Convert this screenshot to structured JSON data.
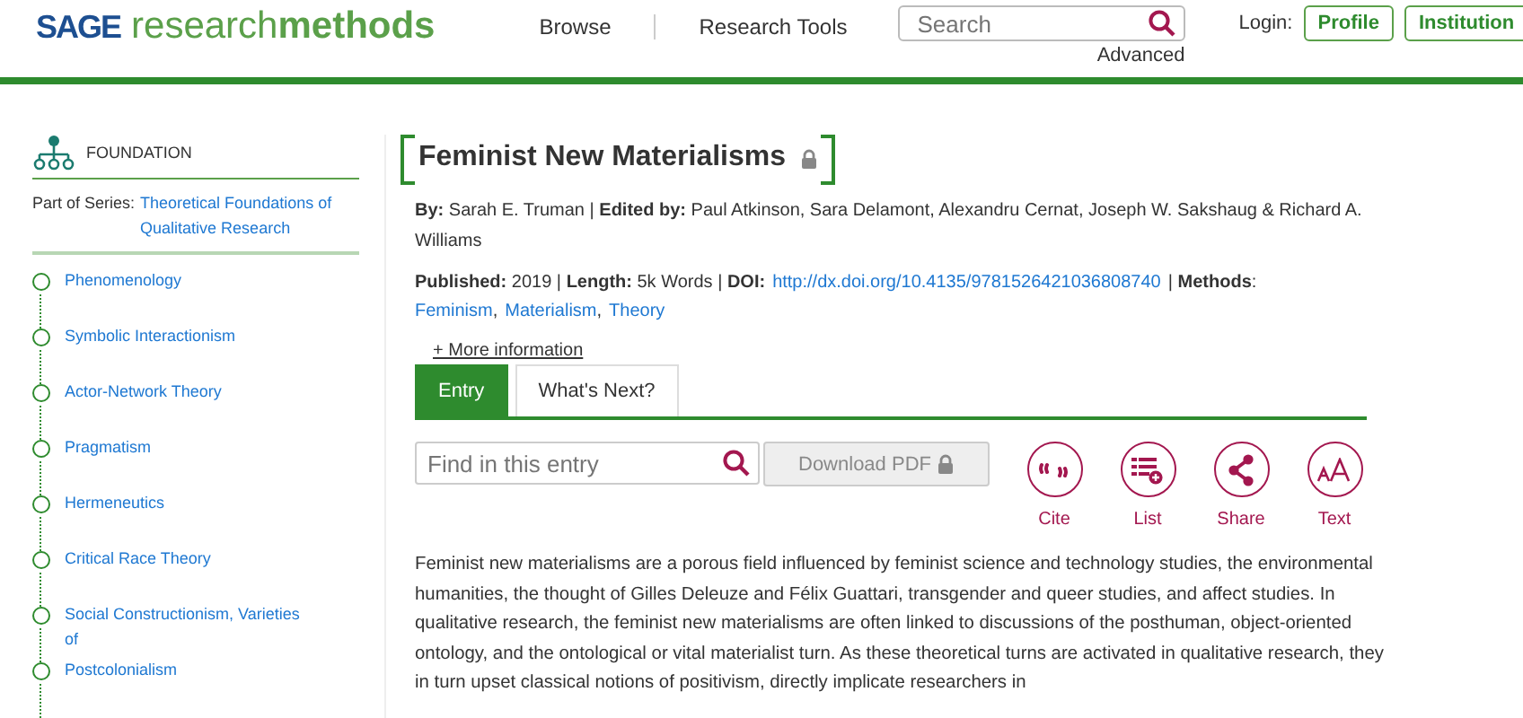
{
  "header": {
    "logo_brand": "SAGE",
    "logo_word_light": "research",
    "logo_word_bold": "methods",
    "nav": [
      "Browse",
      "Research Tools"
    ],
    "search": {
      "placeholder": "Search"
    },
    "advanced": "Advanced",
    "login_label": "Login:",
    "login_buttons": [
      "Profile",
      "Institution"
    ]
  },
  "sidebar": {
    "section": "FOUNDATION",
    "series_label": "Part of Series:",
    "series_link": "Theoretical Foundations of Qualitative Research",
    "items": [
      "Phenomenology",
      "Symbolic Interactionism",
      "Actor-Network Theory",
      "Pragmatism",
      "Hermeneutics",
      "Critical Race Theory",
      "Social Constructionism, Varieties of",
      "Postcolonialism"
    ]
  },
  "article": {
    "title": "Feminist New Materialisms",
    "byline": "**By:** Sarah E. Truman | **Edited by:** Paul Atkinson, Sara Delamont, Alexandru Cernat, Joseph W. Sakshaug & Richard A. Williams",
    "published": "**Published:** 2019 | **Length:** 5k Words | **DOI:**",
    "doi": "http://dx.doi.org/10.4135/9781526421036808740",
    "methods_label": "| **Methods**:",
    "methods": [
      "Feminism",
      "Materialism",
      "Theory"
    ],
    "methods_separator": ",",
    "more_info": "+ More information",
    "tabs": [
      {
        "label": "Entry",
        "selected": true
      },
      {
        "label": "What's Next?",
        "selected": false
      }
    ],
    "find": {
      "placeholder": "Find in this entry"
    },
    "download": "Download PDF",
    "actions": [
      "Cite",
      "List",
      "Share",
      "Text"
    ],
    "body": "Feminist new materialisms are a porous field influenced by feminist science and technology studies, the environmental humanities, the thought of Gilles Deleuze and Félix Guattari, transgender and queer studies, and affect studies. In qualitative research, the feminist new materialisms are often linked to discussions of the posthuman, object-oriented ontology, and the ontological or vital materialist turn. As these theoretical turns are activated in qualitative research, they in turn upset classical notions of positivism, directly implicate researchers in"
  }
}
